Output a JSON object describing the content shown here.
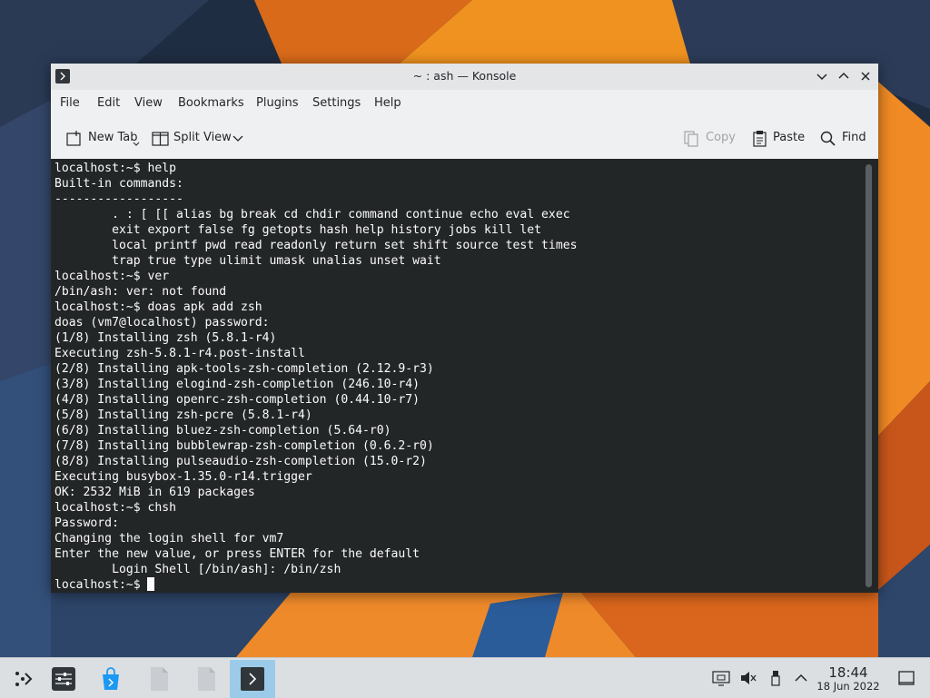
{
  "window": {
    "title": "~ : ash — Konsole",
    "app": "Konsole"
  },
  "menu": {
    "items": [
      "File",
      "Edit",
      "View",
      "Bookmarks",
      "Plugins",
      "Settings",
      "Help"
    ]
  },
  "toolbar": {
    "new_tab": "New Tab",
    "split_view": "Split View",
    "copy": "Copy",
    "paste": "Paste",
    "find": "Find"
  },
  "terminal": {
    "lines": [
      "localhost:~$ help",
      "Built-in commands:",
      "------------------",
      "        . : [ [[ alias bg break cd chdir command continue echo eval exec",
      "        exit export false fg getopts hash help history jobs kill let",
      "        local printf pwd read readonly return set shift source test times",
      "        trap true type ulimit umask unalias unset wait",
      "localhost:~$ ver",
      "/bin/ash: ver: not found",
      "localhost:~$ doas apk add zsh",
      "doas (vm7@localhost) password:",
      "(1/8) Installing zsh (5.8.1-r4)",
      "Executing zsh-5.8.1-r4.post-install",
      "(2/8) Installing apk-tools-zsh-completion (2.12.9-r3)",
      "(3/8) Installing elogind-zsh-completion (246.10-r4)",
      "(4/8) Installing openrc-zsh-completion (0.44.10-r7)",
      "(5/8) Installing zsh-pcre (5.8.1-r4)",
      "(6/8) Installing bluez-zsh-completion (5.64-r0)",
      "(7/8) Installing bubblewrap-zsh-completion (0.6.2-r0)",
      "(8/8) Installing pulseaudio-zsh-completion (15.0-r2)",
      "Executing busybox-1.35.0-r14.trigger",
      "OK: 2532 MiB in 619 packages",
      "localhost:~$ chsh",
      "Password:",
      "Changing the login shell for vm7",
      "Enter the new value, or press ENTER for the default",
      "        Login Shell [/bin/ash]: /bin/zsh"
    ],
    "prompt": "localhost:~$ "
  },
  "taskbar": {
    "tasks": [
      "application-launcher-icon",
      "system-settings-icon",
      "discover-store-icon",
      "window-task-icon",
      "window-task-icon",
      "konsole-icon"
    ],
    "tray": [
      "display-config-icon",
      "volume-muted-icon",
      "usb-device-icon",
      "chevron-up-icon"
    ],
    "clock_time": "18:44",
    "clock_date": "18 Jun 2022",
    "show_desktop": "show-desktop-icon"
  },
  "colors": {
    "terminal_bg": "#232627",
    "terminal_fg": "#fcfcfc",
    "active_task": "#9ccbe9",
    "wallpaper_orange": "#f08a24",
    "wallpaper_blue": "#1d2b3f"
  }
}
